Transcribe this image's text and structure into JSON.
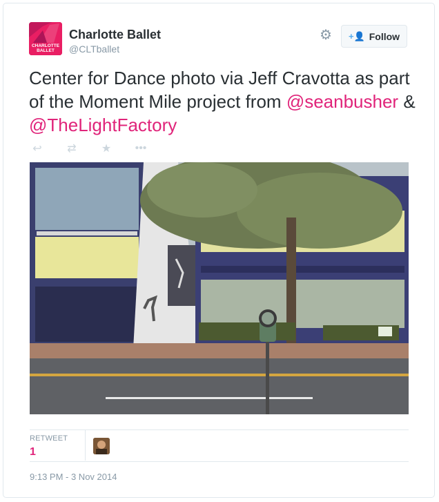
{
  "user": {
    "name": "Charlotte Ballet",
    "handle": "@CLTballet",
    "avatar_text_line1": "CHARLOTTE",
    "avatar_text_line2": "BALLET"
  },
  "header": {
    "gear_icon": "gear-icon",
    "follow_label": "Follow"
  },
  "tweet": {
    "text_part1": "Center for Dance photo via Jeff Cravotta as part of the Moment Mile project from ",
    "mention1": "@seanbusher",
    "text_part2": " & ",
    "mention2": "@TheLightFactory"
  },
  "actions": {
    "reply_icon": "reply-icon",
    "retweet_icon": "retweet-icon",
    "favorite_icon": "star-icon",
    "more_icon": "more-icon"
  },
  "stats": {
    "retweet_label": "RETWEET",
    "retweet_count": "1"
  },
  "timestamp": "9:13 PM - 3 Nov 2014",
  "colors": {
    "accent": "#e0247a",
    "text": "#292f33",
    "muted": "#8899a6",
    "border": "#e1e8ed"
  }
}
